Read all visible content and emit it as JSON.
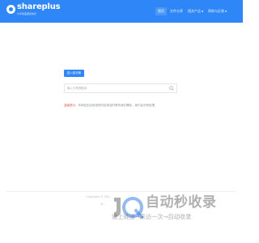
{
  "header": {
    "logo_text": "shareplus",
    "logo_subtitle": "分享创造更多快乐",
    "nav": [
      {
        "label": "首页",
        "active": true,
        "has_dropdown": false
      },
      {
        "label": "文件分享",
        "active": false,
        "has_dropdown": false
      },
      {
        "label": "相关产品",
        "active": false,
        "has_dropdown": true
      },
      {
        "label": "帮助与反馈",
        "active": false,
        "has_dropdown": true
      }
    ]
  },
  "main": {
    "title_button": "进入知识库",
    "search": {
      "placeholder": "输入分享提取码",
      "value": ""
    },
    "notice_label": "温馨提示：",
    "notice_text": "本网站如出现违规内容请及时联系我们删除，我们会尽快处理。"
  },
  "footer": {
    "copyright": "Copyright © 202...",
    "line2": "分..."
  },
  "watermark": {
    "title": "自动秒收录",
    "subtitle": "做上链接→来访一次→自动收录"
  },
  "colors": {
    "primary": "#2f86f6",
    "notice_label": "#e2574c",
    "watermark": "#505050"
  }
}
